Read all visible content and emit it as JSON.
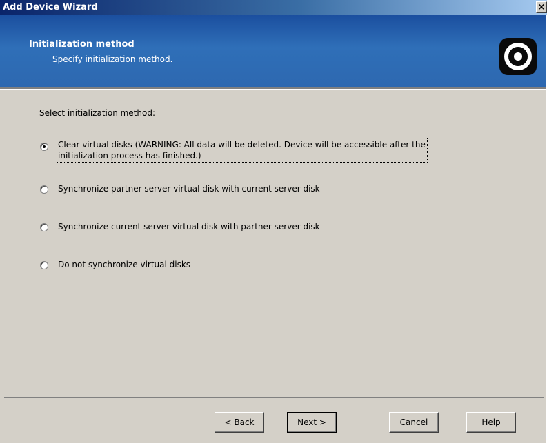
{
  "window": {
    "title": "Add Device Wizard",
    "close_label": "×"
  },
  "header": {
    "title": "Initialization method",
    "subtitle": "Specify initialization method.",
    "logo_icon": "starwind-logo-icon"
  },
  "content": {
    "prompt": "Select initialization method:",
    "options": [
      {
        "line1": "Clear virtual disks (WARNING: All data will be deleted. Device will be accessible after the",
        "line2": "initialization process has finished.)",
        "selected": true
      },
      {
        "label": "Synchronize partner server virtual disk with current server disk",
        "selected": false
      },
      {
        "label": "Synchronize current server virtual disk with partner server disk",
        "selected": false
      },
      {
        "label": "Do not synchronize virtual disks",
        "selected": false
      }
    ]
  },
  "buttons": {
    "back_prefix": "< ",
    "back_mnemonic": "B",
    "back_rest": "ack",
    "next_mnemonic": "N",
    "next_rest": "ext >",
    "cancel": "Cancel",
    "help": "Help"
  },
  "colors": {
    "header_blue": "#2d68b0",
    "title_bar": "#0a246a",
    "dialog_bg": "#d4d0c8"
  }
}
